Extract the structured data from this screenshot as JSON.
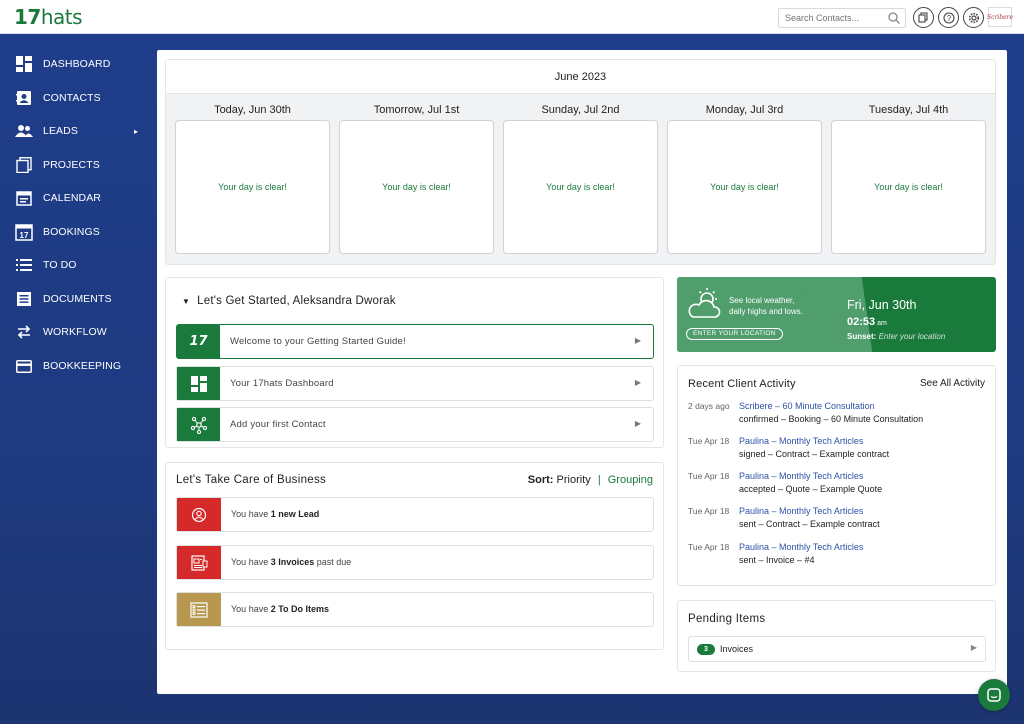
{
  "app": {
    "logo_num": "17",
    "logo_word": "hats"
  },
  "topbar": {
    "search_placeholder": "Search Contacts...",
    "icons": [
      "copy-icon",
      "help-icon",
      "gear-icon"
    ],
    "avatar_text": "Scribere"
  },
  "sidebar": {
    "items": [
      {
        "label": "DASHBOARD",
        "icon": "dashboard-icon"
      },
      {
        "label": "CONTACTS",
        "icon": "contacts-icon"
      },
      {
        "label": "LEADS",
        "icon": "leads-icon",
        "has_submenu": true
      },
      {
        "label": "PROJECTS",
        "icon": "projects-icon"
      },
      {
        "label": "CALENDAR",
        "icon": "calendar-icon"
      },
      {
        "label": "BOOKINGS",
        "icon": "bookings-icon",
        "icon_text": "17"
      },
      {
        "label": "TO DO",
        "icon": "todo-icon"
      },
      {
        "label": "DOCUMENTS",
        "icon": "documents-icon"
      },
      {
        "label": "WORKFLOW",
        "icon": "workflow-icon"
      },
      {
        "label": "BOOKKEEPING",
        "icon": "bookkeeping-icon"
      }
    ]
  },
  "calendar": {
    "month": "June 2023",
    "days": [
      {
        "title": "Today, Jun 30th",
        "message": "Your day is clear!"
      },
      {
        "title": "Tomorrow, Jul 1st",
        "message": "Your day is clear!"
      },
      {
        "title": "Sunday, Jul 2nd",
        "message": "Your day is clear!"
      },
      {
        "title": "Monday, Jul 3rd",
        "message": "Your day is clear!"
      },
      {
        "title": "Tuesday, Jul 4th",
        "message": "Your day is clear!"
      }
    ]
  },
  "getting_started": {
    "title": "Let's Get Started, Aleksandra Dworak",
    "items": [
      {
        "label": "Welcome to your Getting Started Guide!",
        "icon": "17hats-icon",
        "icon_text": "17"
      },
      {
        "label": "Your 17hats Dashboard",
        "icon": "dashboard-icon"
      },
      {
        "label": "Add your first Contact",
        "icon": "network-icon"
      }
    ]
  },
  "business": {
    "title": "Let's Take Care of Business",
    "sort_label": "Sort:",
    "sort_priority": "Priority",
    "sort_sep": "|",
    "sort_grouping": "Grouping",
    "items": [
      {
        "prefix": "You have ",
        "bold": "1 new Lead",
        "suffix": "",
        "color": "#d42a2a",
        "icon": "lead-icon"
      },
      {
        "prefix": "You have ",
        "bold": "3 Invoices",
        "suffix": " past due",
        "color": "#d42a2a",
        "icon": "invoice-icon"
      },
      {
        "prefix": "You have ",
        "bold": "2 To Do Items",
        "suffix": "",
        "color": "#b8984e",
        "icon": "checklist-icon"
      }
    ]
  },
  "weather": {
    "line1": "See local weather,",
    "line2": "daily highs and lows.",
    "button": "ENTER YOUR LOCATION",
    "date": "Fri, Jun 30th",
    "time": "02:53",
    "ampm": "am",
    "sunset_label": "Sunset:",
    "sunset_value": "Enter your location"
  },
  "recent_activity": {
    "title": "Recent Client Activity",
    "see_all": "See All Activity",
    "items": [
      {
        "when": "2 days ago",
        "who": "Scribere – 60 Minute Consultation",
        "what": "confirmed – Booking – 60 Minute Consultation"
      },
      {
        "when": "Tue Apr 18",
        "who": "Paulina – Monthly Tech Articles",
        "what": "signed – Contract – Example contract"
      },
      {
        "when": "Tue Apr 18",
        "who": "Paulina – Monthly Tech Articles",
        "what": "accepted – Quote – Example Quote"
      },
      {
        "when": "Tue Apr 18",
        "who": "Paulina – Monthly Tech Articles",
        "what": "sent – Contract – Example contract"
      },
      {
        "when": "Tue Apr 18",
        "who": "Paulina – Monthly Tech Articles",
        "what": "sent – Invoice – #4"
      }
    ]
  },
  "pending": {
    "title": "Pending Items",
    "items": [
      {
        "count": "3",
        "label": "Invoices"
      }
    ]
  },
  "colors": {
    "brand_green": "#1a7a3c",
    "sidebar_blue": "#1f3d8a",
    "alert_red": "#d42a2a",
    "todo_gold": "#b8984e",
    "link_blue": "#2f52a6"
  }
}
